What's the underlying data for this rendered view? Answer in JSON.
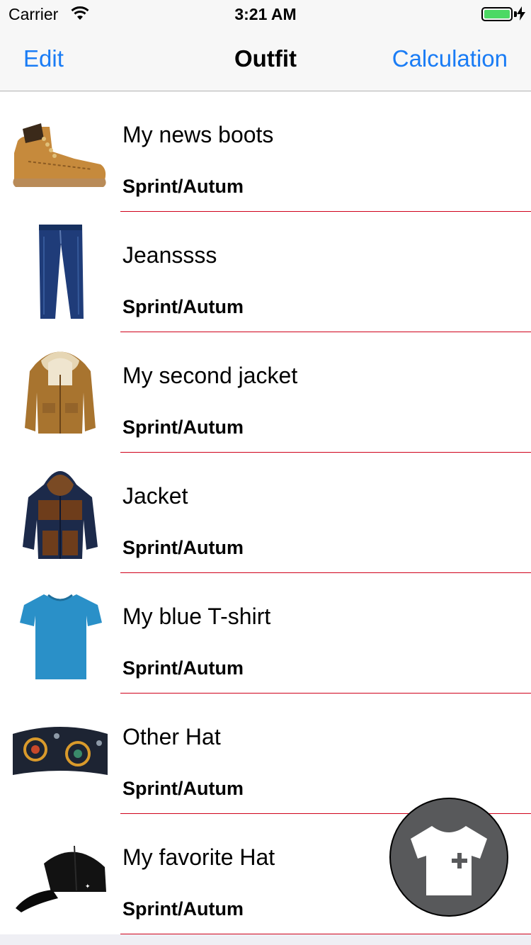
{
  "status_bar": {
    "carrier": "Carrier",
    "time": "3:21 AM",
    "battery_color": "#4cd964"
  },
  "nav": {
    "left_label": "Edit",
    "title": "Outfit",
    "right_label": "Calculation",
    "accent_color": "#1a7cf5"
  },
  "items": [
    {
      "title": "My news boots",
      "season": "Sprint/Autum",
      "icon": "boot-image"
    },
    {
      "title": "Jeanssss",
      "season": "Sprint/Autum",
      "icon": "jeans-image"
    },
    {
      "title": "My second jacket",
      "season": "Sprint/Autum",
      "icon": "parka-jacket-image"
    },
    {
      "title": "Jacket",
      "season": "Sprint/Autum",
      "icon": "hooded-jacket-image"
    },
    {
      "title": "My blue T-shirt",
      "season": "Sprint/Autum",
      "icon": "blue-tshirt-image"
    },
    {
      "title": "Other Hat",
      "season": "Sprint/Autum",
      "icon": "headband-image"
    },
    {
      "title": "My favorite Hat",
      "season": "Sprint/Autum",
      "icon": "cap-image"
    }
  ],
  "separator_color": "#d0021b",
  "fab": {
    "icon": "add-shirt-icon",
    "color": "#58595b"
  }
}
